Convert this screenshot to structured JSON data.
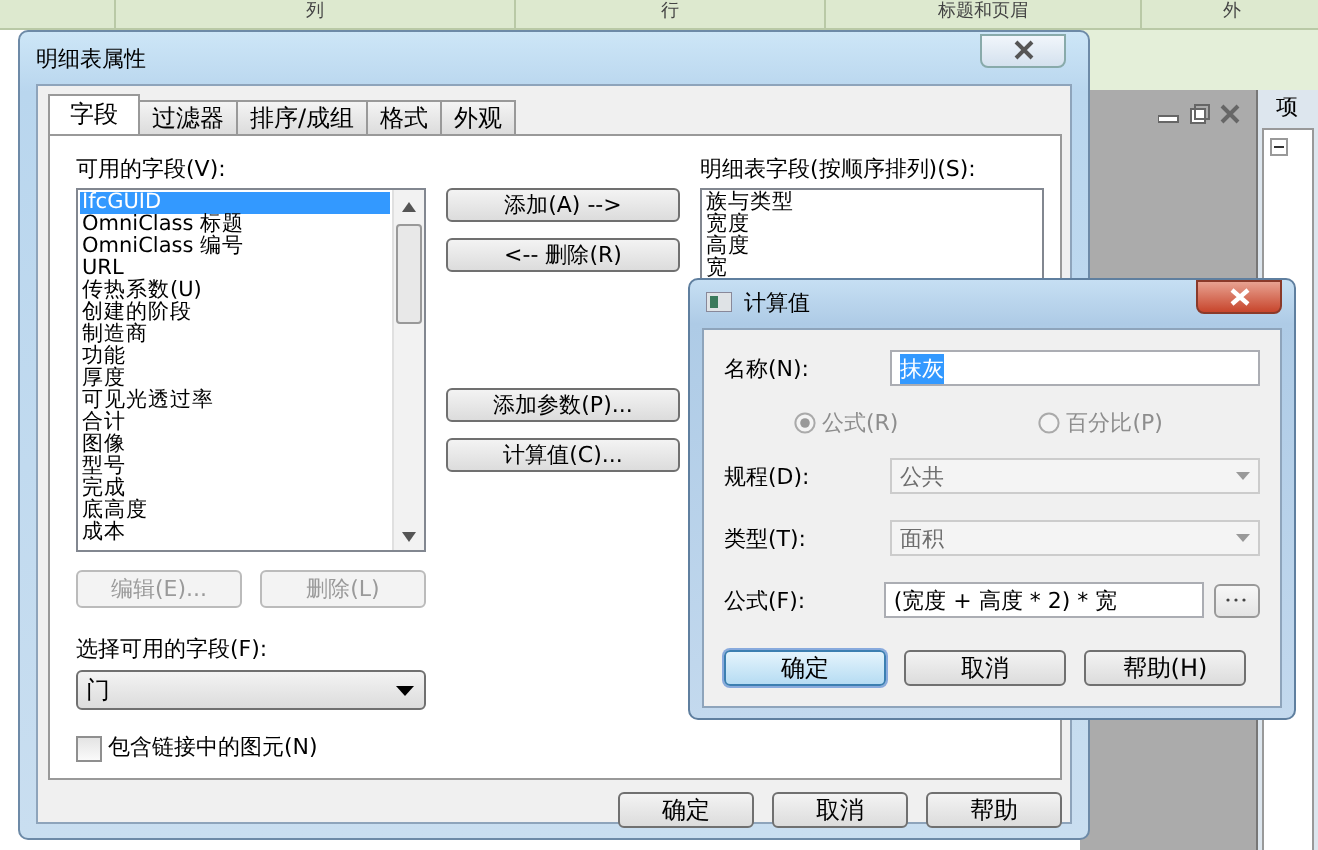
{
  "background": {
    "header_columns": [
      "列",
      "行",
      "标题和页眉",
      "外"
    ],
    "panel_title": "项"
  },
  "dialog": {
    "title": "明细表属性",
    "tabs": [
      {
        "label": "字段",
        "selected": true
      },
      {
        "label": "过滤器",
        "selected": false
      },
      {
        "label": "排序/成组",
        "selected": false
      },
      {
        "label": "格式",
        "selected": false
      },
      {
        "label": "外观",
        "selected": false
      }
    ],
    "available_label": "可用的字段(V):",
    "available_fields": [
      {
        "label": "IfcGUID",
        "selected": true
      },
      {
        "label": "OmniClass 标题",
        "selected": false
      },
      {
        "label": "OmniClass 编号",
        "selected": false
      },
      {
        "label": "URL",
        "selected": false
      },
      {
        "label": "传热系数(U)",
        "selected": false
      },
      {
        "label": "创建的阶段",
        "selected": false
      },
      {
        "label": "制造商",
        "selected": false
      },
      {
        "label": "功能",
        "selected": false
      },
      {
        "label": "厚度",
        "selected": false
      },
      {
        "label": "可见光透过率",
        "selected": false
      },
      {
        "label": "合计",
        "selected": false
      },
      {
        "label": "图像",
        "selected": false
      },
      {
        "label": "型号",
        "selected": false
      },
      {
        "label": "完成",
        "selected": false
      },
      {
        "label": "底高度",
        "selected": false
      },
      {
        "label": "成本",
        "selected": false
      }
    ],
    "middle_buttons": [
      {
        "label": "添加(A) -->",
        "disabled": false
      },
      {
        "label": "<-- 删除(R)",
        "disabled": false
      },
      {
        "label": "添加参数(P)...",
        "disabled": false
      },
      {
        "label": "计算值(C)...",
        "disabled": false
      }
    ],
    "scheduled_label": "明细表字段(按顺序排列)(S):",
    "scheduled_fields": [
      "族与类型",
      "宽度",
      "高度",
      "宽"
    ],
    "edit_buttons": [
      {
        "label": "编辑(E)...",
        "disabled": true
      },
      {
        "label": "删除(L)",
        "disabled": true
      }
    ],
    "select_label": "选择可用的字段(F):",
    "select_value": "门",
    "include_linked": {
      "label": "包含链接中的图元(N)",
      "checked": false
    },
    "buttons": [
      "确定",
      "取消",
      "帮助"
    ]
  },
  "calc_dialog": {
    "title": "计算值",
    "name_label": "名称(N):",
    "name_value": "抹灰",
    "radios": [
      {
        "label": "公式(R)",
        "selected": true,
        "disabled": true
      },
      {
        "label": "百分比(P)",
        "selected": false,
        "disabled": true
      }
    ],
    "discipline": {
      "label": "规程(D):",
      "value": "公共",
      "disabled": true
    },
    "type": {
      "label": "类型(T):",
      "value": "面积",
      "disabled": true
    },
    "formula_label": "公式(F):",
    "formula_value": "(宽度 + 高度 * 2) * 宽",
    "buttons": [
      {
        "label": "确定",
        "default": true
      },
      {
        "label": "取消",
        "default": false
      },
      {
        "label": "帮助(H)",
        "default": false
      }
    ]
  }
}
